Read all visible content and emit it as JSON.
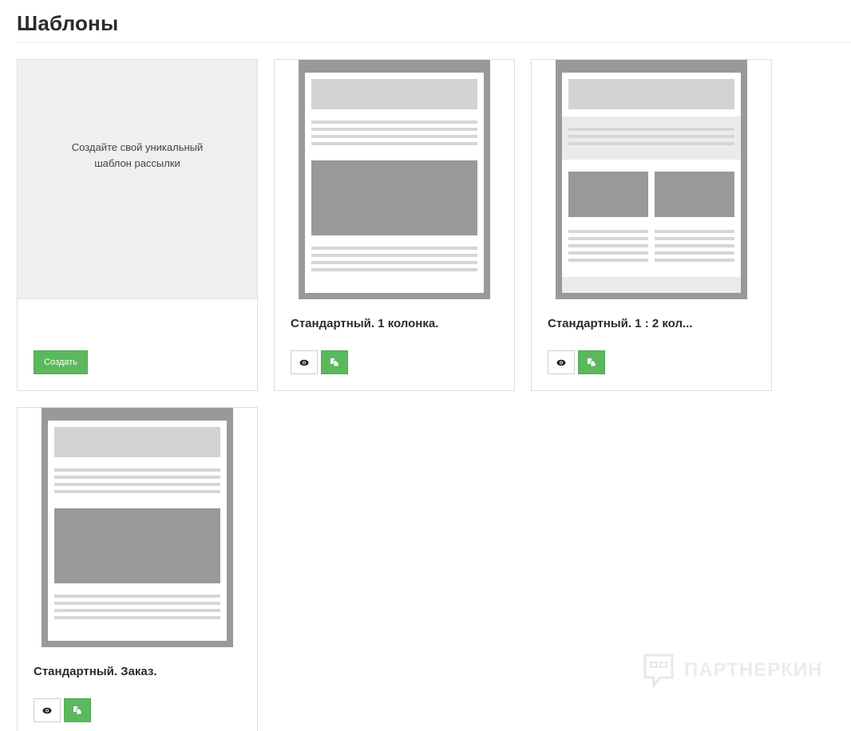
{
  "page": {
    "title": "Шаблоны"
  },
  "create_card": {
    "text_line1": "Создайте свой уникальный",
    "text_line2": "шаблон рассылки",
    "button_label": "Создать"
  },
  "templates": [
    {
      "title": "Стандартный. 1 колонка.",
      "layout": "one-column"
    },
    {
      "title": "Стандартный. 1 : 2 кол...",
      "layout": "one-two-columns"
    },
    {
      "title": "Стандартный. Заказ.",
      "layout": "order"
    }
  ],
  "icons": {
    "view": "eye-icon",
    "copy": "copy-icon"
  },
  "colors": {
    "accent": "#5cb85c",
    "thumb_frame": "#999999",
    "thumb_light": "#d3d3d3"
  },
  "watermark": {
    "text": "ПАРТНЕРКИН"
  }
}
